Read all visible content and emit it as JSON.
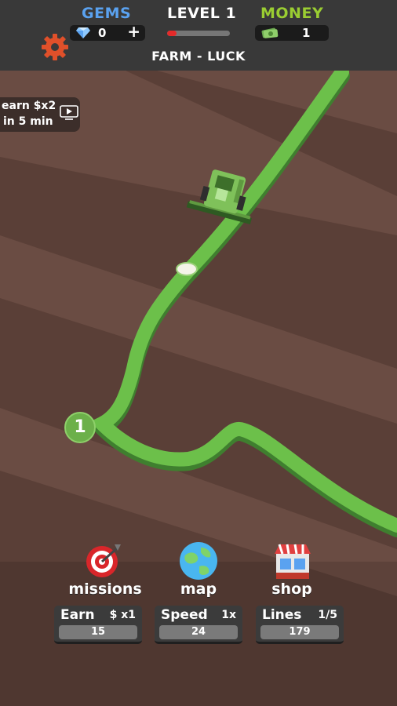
{
  "hud": {
    "gems_label": "GEMS",
    "gems_value": "0",
    "gems_plus": "+",
    "level_label": "LEVEL 1",
    "level_progress": 0.15,
    "money_label": "MONEY",
    "money_value": "1",
    "field_name": "FARM - LUCK"
  },
  "promo": {
    "line1": "earn $x2",
    "line2": "in 5 min"
  },
  "field": {
    "checkpoint_number": "1"
  },
  "menu": {
    "missions": "missions",
    "map": "map",
    "shop": "shop"
  },
  "stats": {
    "earn": {
      "name": "Earn",
      "mult": "$ x1",
      "value": "15"
    },
    "speed": {
      "name": "Speed",
      "mult": "1x",
      "value": "24"
    },
    "lines": {
      "name": "Lines",
      "mult": "1/5",
      "value": "179"
    }
  },
  "colors": {
    "gems": "#5aa2f0",
    "money": "#9acd32",
    "path": "#6cc04a",
    "progress": "#e52a2a",
    "gear": "#e0502a"
  }
}
